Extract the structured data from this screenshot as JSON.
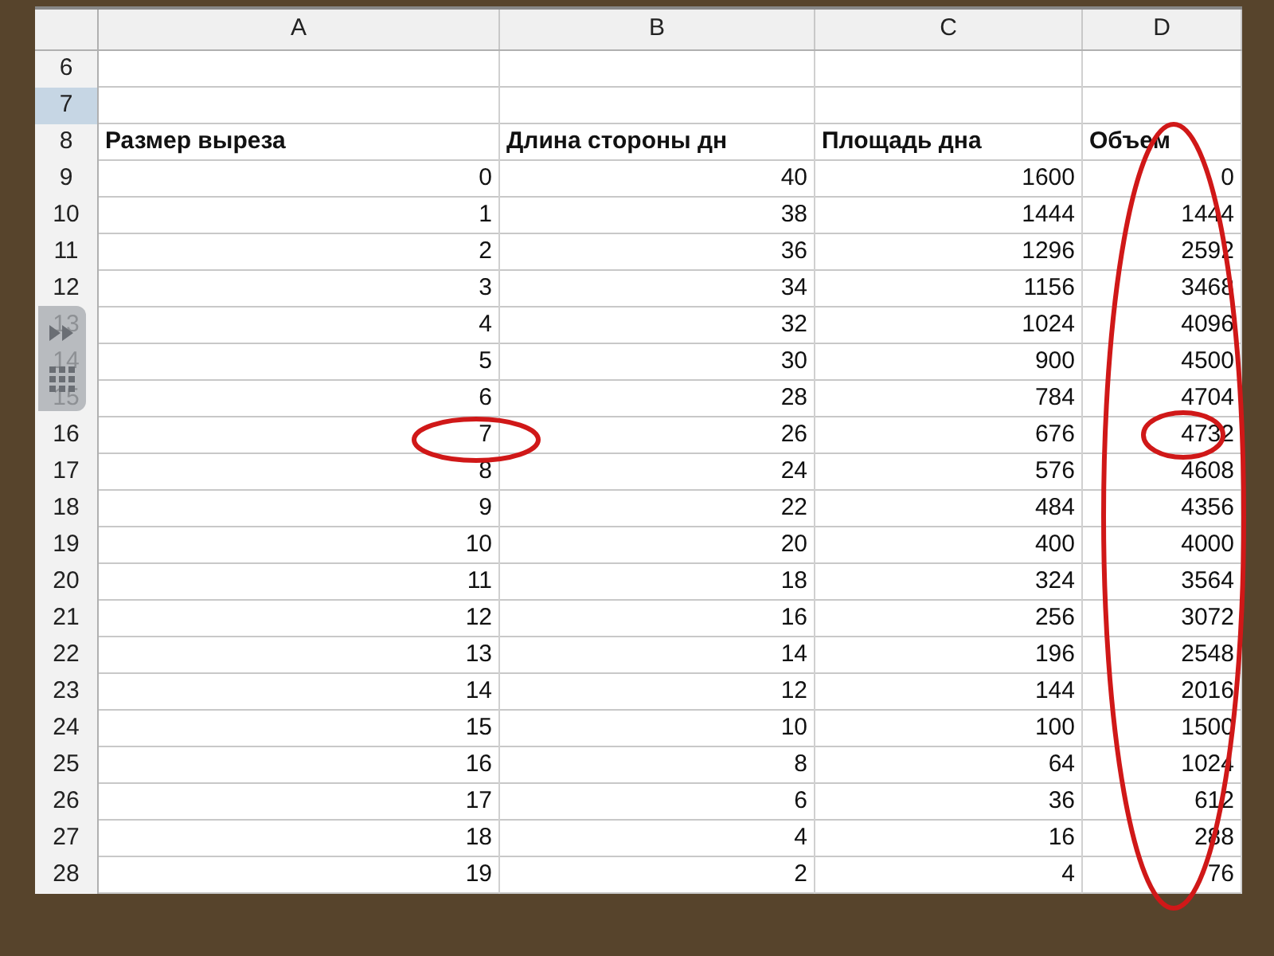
{
  "columns": [
    {
      "label": "A"
    },
    {
      "label": "B"
    },
    {
      "label": "C"
    },
    {
      "label": "D"
    }
  ],
  "rows": [
    {
      "number": "6",
      "selected": false,
      "kind": "empty"
    },
    {
      "number": "7",
      "selected": true,
      "kind": "empty"
    },
    {
      "number": "8",
      "selected": false,
      "kind": "heading",
      "cells": [
        "Размер выреза",
        "Длина стороны дн",
        "Площадь дна",
        "Объем"
      ]
    },
    {
      "number": "9",
      "selected": false,
      "kind": "data",
      "cells": [
        "0",
        "40",
        "1600",
        "0"
      ]
    },
    {
      "number": "10",
      "selected": false,
      "kind": "data",
      "cells": [
        "1",
        "38",
        "1444",
        "1444"
      ]
    },
    {
      "number": "11",
      "selected": false,
      "kind": "data",
      "cells": [
        "2",
        "36",
        "1296",
        "2592"
      ]
    },
    {
      "number": "12",
      "selected": false,
      "kind": "data",
      "cells": [
        "3",
        "34",
        "1156",
        "3468"
      ]
    },
    {
      "number": "13",
      "selected": false,
      "kind": "data",
      "cells": [
        "4",
        "32",
        "1024",
        "4096"
      ]
    },
    {
      "number": "14",
      "selected": false,
      "kind": "data",
      "cells": [
        "5",
        "30",
        "900",
        "4500"
      ]
    },
    {
      "number": "15",
      "selected": false,
      "kind": "data",
      "cells": [
        "6",
        "28",
        "784",
        "4704"
      ]
    },
    {
      "number": "16",
      "selected": false,
      "kind": "data",
      "cells": [
        "7",
        "26",
        "676",
        "4732"
      ]
    },
    {
      "number": "17",
      "selected": false,
      "kind": "data",
      "cells": [
        "8",
        "24",
        "576",
        "4608"
      ]
    },
    {
      "number": "18",
      "selected": false,
      "kind": "data",
      "cells": [
        "9",
        "22",
        "484",
        "4356"
      ]
    },
    {
      "number": "19",
      "selected": false,
      "kind": "data",
      "cells": [
        "10",
        "20",
        "400",
        "4000"
      ]
    },
    {
      "number": "20",
      "selected": false,
      "kind": "data",
      "cells": [
        "11",
        "18",
        "324",
        "3564"
      ]
    },
    {
      "number": "21",
      "selected": false,
      "kind": "data",
      "cells": [
        "12",
        "16",
        "256",
        "3072"
      ]
    },
    {
      "number": "22",
      "selected": false,
      "kind": "data",
      "cells": [
        "13",
        "14",
        "196",
        "2548"
      ]
    },
    {
      "number": "23",
      "selected": false,
      "kind": "data",
      "cells": [
        "14",
        "12",
        "144",
        "2016"
      ]
    },
    {
      "number": "24",
      "selected": false,
      "kind": "data",
      "cells": [
        "15",
        "10",
        "100",
        "1500"
      ]
    },
    {
      "number": "25",
      "selected": false,
      "kind": "data",
      "cells": [
        "16",
        "8",
        "64",
        "1024"
      ]
    },
    {
      "number": "26",
      "selected": false,
      "kind": "data",
      "cells": [
        "17",
        "6",
        "36",
        "612"
      ]
    },
    {
      "number": "27",
      "selected": false,
      "kind": "data",
      "cells": [
        "18",
        "4",
        "16",
        "288"
      ]
    },
    {
      "number": "28",
      "selected": false,
      "kind": "data",
      "cells": [
        "19",
        "2",
        "4",
        "76"
      ]
    }
  ]
}
